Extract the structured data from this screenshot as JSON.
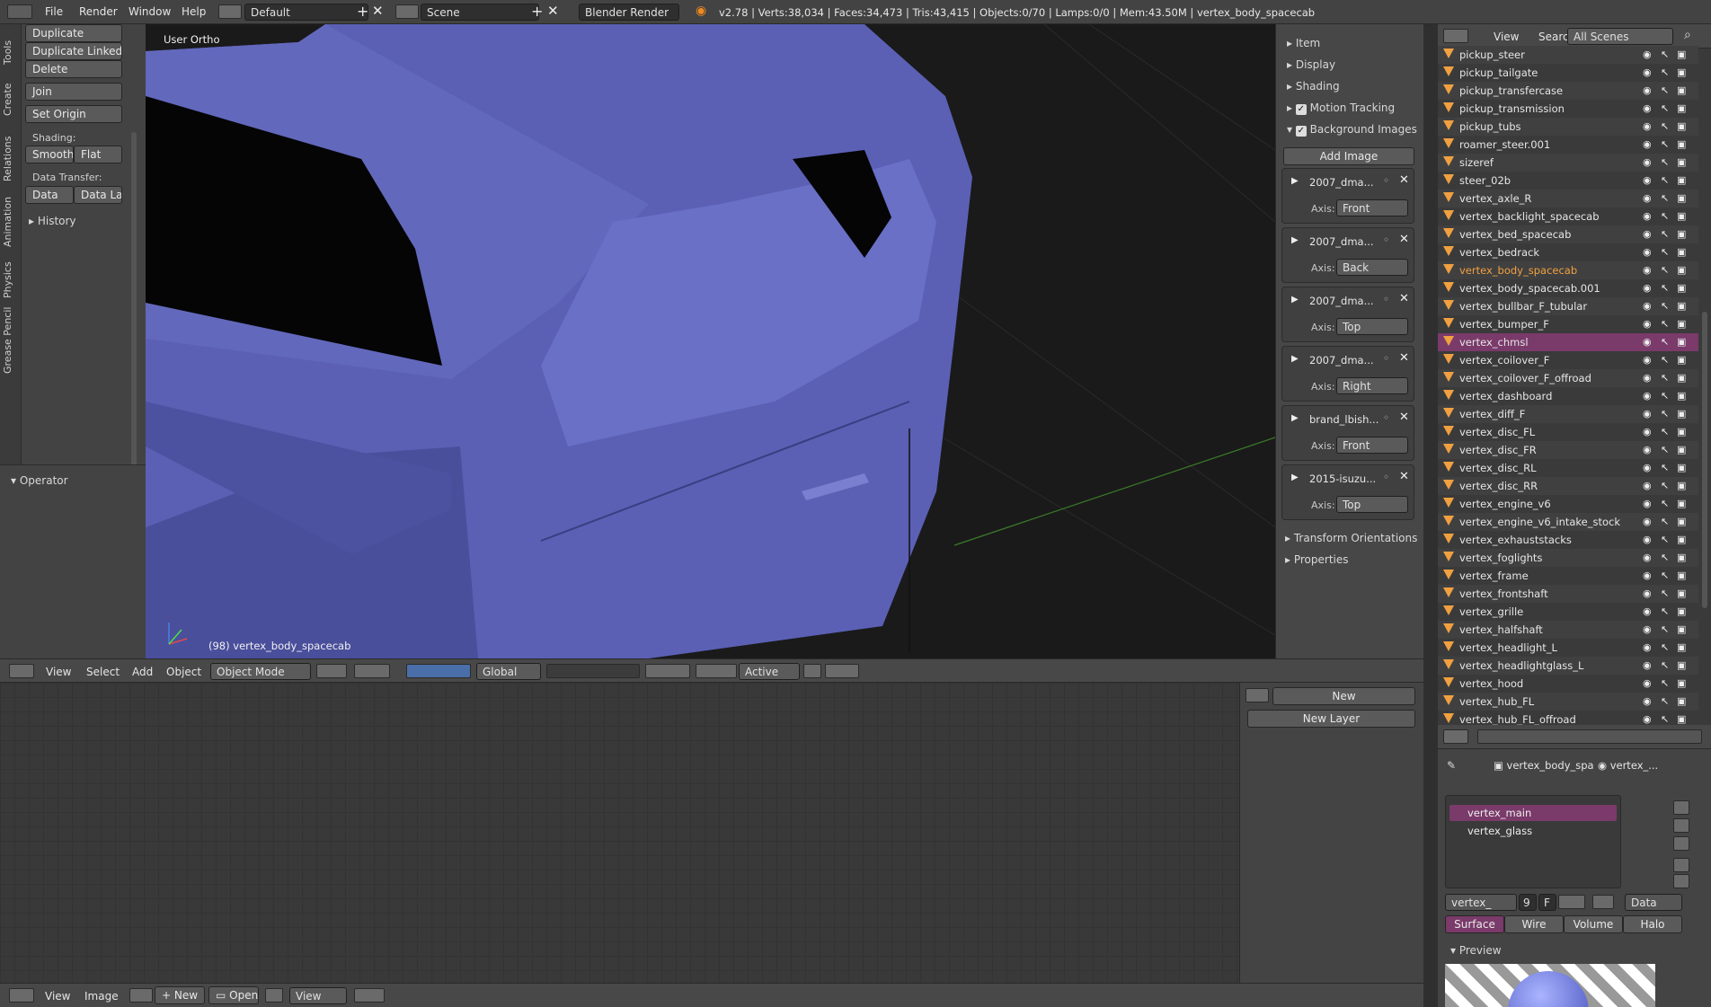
{
  "info_bar": {
    "menus": [
      "File",
      "Render",
      "Window",
      "Help"
    ],
    "layout": "Default",
    "scene": "Scene",
    "engine": "Blender Render",
    "stats": "v2.78 | Verts:38,034 | Faces:34,473 | Tris:43,415 | Objects:0/70 | Lamps:0/0 | Mem:43.50M | vertex_body_spacecab"
  },
  "toolshelf": {
    "tabs": [
      "Tools",
      "Create",
      "Relations",
      "Animation",
      "Physics",
      "Grease Pencil"
    ],
    "duplicate": "Duplicate",
    "duplicate_linked": "Duplicate Linked",
    "delete": "Delete",
    "join": "Join",
    "set_origin": "Set Origin",
    "shading_label": "Shading:",
    "smooth": "Smooth",
    "flat": "Flat",
    "data_transfer_label": "Data Transfer:",
    "data": "Data",
    "data_lay": "Data Lay",
    "history": "History",
    "operator": "Operator"
  },
  "viewport": {
    "view_name": "User Ortho",
    "object_label": "(98) vertex_body_spacecab",
    "header": {
      "view": "View",
      "select": "Select",
      "add": "Add",
      "object": "Object",
      "mode": "Object Mode",
      "orientation": "Global",
      "pivot": "Active"
    }
  },
  "properties_panel": {
    "item": "Item",
    "display": "Display",
    "shading": "Shading",
    "motion_tracking": "Motion Tracking",
    "background_images": "Background Images",
    "add_image": "Add Image",
    "axis_label": "Axis:",
    "images": [
      {
        "name": "2007_dma...",
        "axis": "Front"
      },
      {
        "name": "2007_dma...",
        "axis": "Back"
      },
      {
        "name": "2007_dma...",
        "axis": "Top"
      },
      {
        "name": "2007_dma...",
        "axis": "Right"
      },
      {
        "name": "brand_lbish...",
        "axis": "Front"
      },
      {
        "name": "2015-isuzu...",
        "axis": "Top"
      }
    ],
    "transform_orientations": "Transform Orientations",
    "properties": "Properties"
  },
  "image_editor": {
    "new": "New",
    "new_layer": "New Layer",
    "footer": {
      "view": "View",
      "image": "Image",
      "new": "New",
      "open": "Open",
      "view2": "View"
    }
  },
  "outliner": {
    "view": "View",
    "search": "Search",
    "scenes": "All Scenes",
    "rows": [
      "pickup_steer",
      "pickup_tailgate",
      "pickup_transfercase",
      "pickup_transmission",
      "pickup_tubs",
      "roamer_steer.001",
      "sizeref",
      "steer_02b",
      "vertex_axle_R",
      "vertex_backlight_spacecab",
      "vertex_bed_spacecab",
      "vertex_bedrack",
      "vertex_body_spacecab",
      "vertex_body_spacecab.001",
      "vertex_bullbar_F_tubular",
      "vertex_bumper_F",
      "vertex_chmsl",
      "vertex_coilover_F",
      "vertex_coilover_F_offroad",
      "vertex_dashboard",
      "vertex_diff_F",
      "vertex_disc_FL",
      "vertex_disc_FR",
      "vertex_disc_RL",
      "vertex_disc_RR",
      "vertex_engine_v6",
      "vertex_engine_v6_intake_stock",
      "vertex_exhauststacks",
      "vertex_foglights",
      "vertex_frame",
      "vertex_frontshaft",
      "vertex_grille",
      "vertex_halfshaft",
      "vertex_headlight_L",
      "vertex_headlightglass_L",
      "vertex_hood",
      "vertex_hub_FL",
      "vertex_hub_FL_offroad"
    ],
    "active_row": "vertex_body_spacecab",
    "highlight_row": "vertex_chmsl"
  },
  "material_panel": {
    "object": "vertex_body_spa",
    "material_short": "vertex_...",
    "slots": [
      "vertex_main",
      "vertex_glass"
    ],
    "mat_name": "vertex_",
    "users": "9",
    "fake": "F",
    "link": "Data",
    "tabs": [
      "Surface",
      "Wire",
      "Volume",
      "Halo"
    ],
    "preview": "Preview"
  },
  "colors": {
    "accent_orange": "#f0a040",
    "selected_row": "#7a3a6a",
    "surface_tab": "#7a3a6a",
    "mesh": "#5d63b8"
  }
}
